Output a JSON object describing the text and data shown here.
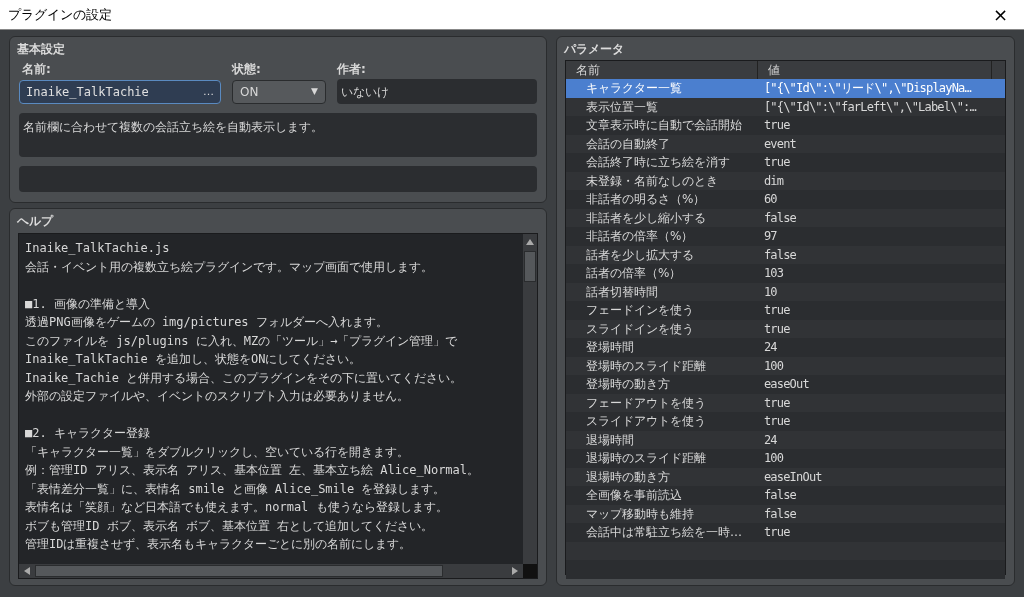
{
  "window": {
    "title": "プラグインの設定",
    "close": "×"
  },
  "basic": {
    "title": "基本設定",
    "name_label": "名前:",
    "name_value": "Inaike_TalkTachie",
    "name_button": "…",
    "status_label": "状態:",
    "status_value": "ON",
    "status_arrow": "▼",
    "author_label": "作者:",
    "author_value": "いないけ",
    "description": "名前欄に合わせて複数の会話立ち絵を自動表示します。"
  },
  "help": {
    "title": "ヘルプ",
    "paragraphs": [
      [
        "Inaike_TalkTachie.js",
        "会話・イベント用の複数立ち絵プラグインです。マップ画面で使用します。"
      ],
      [
        "■1. 画像の準備と導入",
        "透過PNG画像をゲームの img/pictures フォルダーへ入れます。",
        "このファイルを js/plugins に入れ、MZの「ツール」→「プラグイン管理」で",
        "Inaike_TalkTachie を追加し、状態をONにしてください。",
        "Inaike_Tachie と併用する場合、このプラグインをその下に置いてください。",
        "外部の設定ファイルや、イベントのスクリプト入力は必要ありません。"
      ],
      [
        "■2. キャラクター登録",
        "「キャラクター一覧」をダブルクリックし、空いている行を開きます。",
        "例：管理ID アリス、表示名 アリス、基本位置 左、基本立ち絵 Alice_Normal。",
        "「表情差分一覧」に、表情名 smile と画像 Alice_Smile を登録します。",
        "表情名は「笑顔」など日本語でも使えます。normal も使うなら登録します。",
        "ボブも管理ID ボブ、表示名 ボブ、基本位置 右として追加してください。",
        "管理IDは重複させず、表示名もキャラクターごとに別の名前にします。"
      ]
    ]
  },
  "parameters": {
    "title": "パラメータ",
    "columns": [
      "名前",
      "値"
    ],
    "rows": [
      {
        "name": "キャラクター一覧",
        "value": "[\"{\\\"Id\\\":\\\"リード\\\",\\\"DisplayNa…",
        "selected": true
      },
      {
        "name": "表示位置一覧",
        "value": "[\"{\\\"Id\\\":\\\"farLeft\\\",\\\"Label\\\":…",
        "selected": false
      },
      {
        "name": "文章表示時に自動で会話開始",
        "value": "true",
        "selected": false
      },
      {
        "name": "会話の自動終了",
        "value": "event",
        "selected": false
      },
      {
        "name": "会話終了時に立ち絵を消す",
        "value": "true",
        "selected": false
      },
      {
        "name": "未登録・名前なしのとき",
        "value": "dim",
        "selected": false
      },
      {
        "name": "非話者の明るさ（%）",
        "value": "60",
        "selected": false
      },
      {
        "name": "非話者を少し縮小する",
        "value": "false",
        "selected": false
      },
      {
        "name": "非話者の倍率（%）",
        "value": "97",
        "selected": false
      },
      {
        "name": "話者を少し拡大する",
        "value": "false",
        "selected": false
      },
      {
        "name": "話者の倍率（%）",
        "value": "103",
        "selected": false
      },
      {
        "name": "話者切替時間",
        "value": "10",
        "selected": false
      },
      {
        "name": "フェードインを使う",
        "value": "true",
        "selected": false
      },
      {
        "name": "スライドインを使う",
        "value": "true",
        "selected": false
      },
      {
        "name": "登場時間",
        "value": "24",
        "selected": false
      },
      {
        "name": "登場時のスライド距離",
        "value": "100",
        "selected": false
      },
      {
        "name": "登場時の動き方",
        "value": "easeOut",
        "selected": false
      },
      {
        "name": "フェードアウトを使う",
        "value": "true",
        "selected": false
      },
      {
        "name": "スライドアウトを使う",
        "value": "true",
        "selected": false
      },
      {
        "name": "退場時間",
        "value": "24",
        "selected": false
      },
      {
        "name": "退場時のスライド距離",
        "value": "100",
        "selected": false
      },
      {
        "name": "退場時の動き方",
        "value": "easeInOut",
        "selected": false
      },
      {
        "name": "全画像を事前読込",
        "value": "false",
        "selected": false
      },
      {
        "name": "マップ移動時も維持",
        "value": "false",
        "selected": false
      },
      {
        "name": "会話中は常駐立ち絵を一時…",
        "value": "true",
        "selected": false
      }
    ]
  }
}
